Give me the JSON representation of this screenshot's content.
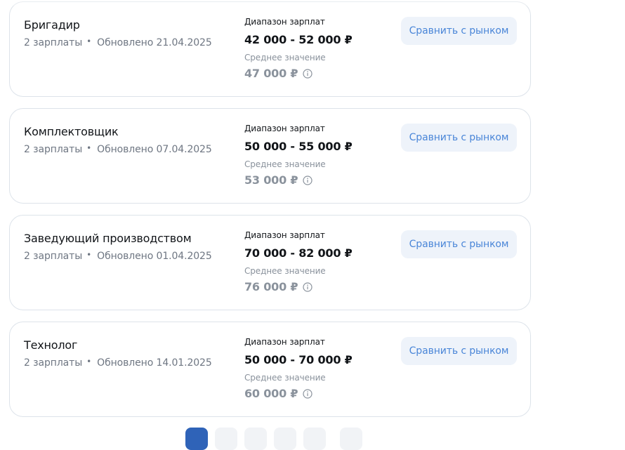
{
  "labels": {
    "range": "Диапазон зарплат",
    "average": "Среднее значение",
    "compare_button": "Сравнить с рынком",
    "separator": "•"
  },
  "cards": [
    {
      "title": "Бригадир",
      "count": "2 зарплаты",
      "updated": "Обновлено 21.04.2025",
      "range": "42 000 - 52 000 ₽",
      "average": "47 000 ₽"
    },
    {
      "title": "Комплектовщик",
      "count": "2 зарплаты",
      "updated": "Обновлено 07.04.2025",
      "range": "50 000 - 55 000 ₽",
      "average": "53 000 ₽"
    },
    {
      "title": "Заведующий производством",
      "count": "2 зарплаты",
      "updated": "Обновлено 01.04.2025",
      "range": "70 000 - 82 000 ₽",
      "average": "76 000 ₽"
    },
    {
      "title": "Технолог",
      "count": "2 зарплаты",
      "updated": "Обновлено 14.01.2025",
      "range": "50 000 - 70 000 ₽",
      "average": "60 000 ₽"
    }
  ],
  "pagination": {
    "active_page_index": 0
  },
  "colors": {
    "accent": "#4a86d8",
    "button_bg": "#eef3fa",
    "active_page": "#2f63b8"
  }
}
